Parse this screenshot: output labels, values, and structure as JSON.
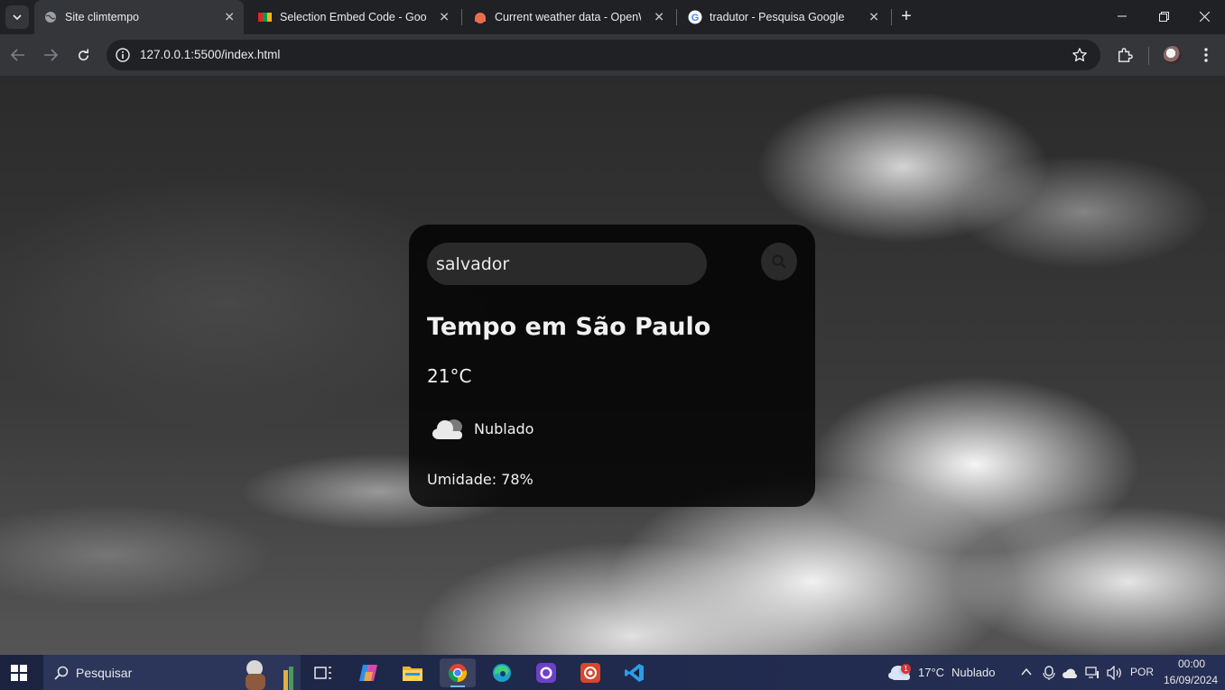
{
  "browser": {
    "tabs": [
      {
        "title": "Site climtempo",
        "active": true,
        "icon": "globe-icon"
      },
      {
        "title": "Selection Embed Code - Google",
        "active": false,
        "icon": "zoho-icon"
      },
      {
        "title": "Current weather data - OpenWe",
        "active": false,
        "icon": "openweather-icon"
      },
      {
        "title": "tradutor - Pesquisa Google",
        "active": false,
        "icon": "google-icon"
      }
    ],
    "url": "127.0.0.1:5500/index.html"
  },
  "weather": {
    "search_value": "salvador",
    "title": "Tempo em São Paulo",
    "temperature": "21°C",
    "description": "Nublado",
    "humidity": "Umidade: 78%"
  },
  "taskbar": {
    "search_placeholder": "Pesquisar",
    "weather_temp": "17°C",
    "weather_desc": "Nublado",
    "weather_badge": "1",
    "language": "POR",
    "time": "00:00",
    "date": "16/09/2024"
  }
}
